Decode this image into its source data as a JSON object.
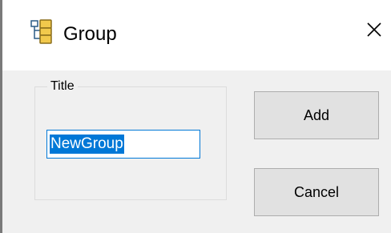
{
  "window": {
    "title": "Group",
    "icon": "group-tree-icon",
    "close_icon": "close-icon"
  },
  "group_box": {
    "legend": "Title",
    "input_value": "NewGroup",
    "input_selected": true
  },
  "buttons": {
    "add_label": "Add",
    "cancel_label": "Cancel"
  },
  "colors": {
    "accent": "#0078d7",
    "button_face": "#e1e1e1",
    "client_background": "#f0f0f0"
  }
}
